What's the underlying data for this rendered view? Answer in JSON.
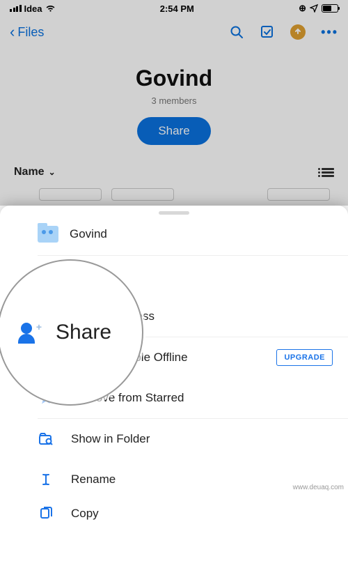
{
  "status": {
    "carrier": "Idea",
    "time": "2:54 PM"
  },
  "nav": {
    "back_label": "Files"
  },
  "folder": {
    "title": "Govind",
    "subtitle": "3 members",
    "share_label": "Share"
  },
  "sort": {
    "label": "Name"
  },
  "sheet": {
    "title": "Govind",
    "rows": {
      "share": "Share",
      "manage": "Manage Access",
      "offline": "Make Available Offline",
      "upgrade": "UPGRADE",
      "unstar": "Remove from Starred",
      "show": "Show in Folder",
      "rename": "Rename",
      "copy": "Copy"
    }
  },
  "zoom": {
    "label": "Share"
  },
  "watermark": "www.deuaq.com"
}
